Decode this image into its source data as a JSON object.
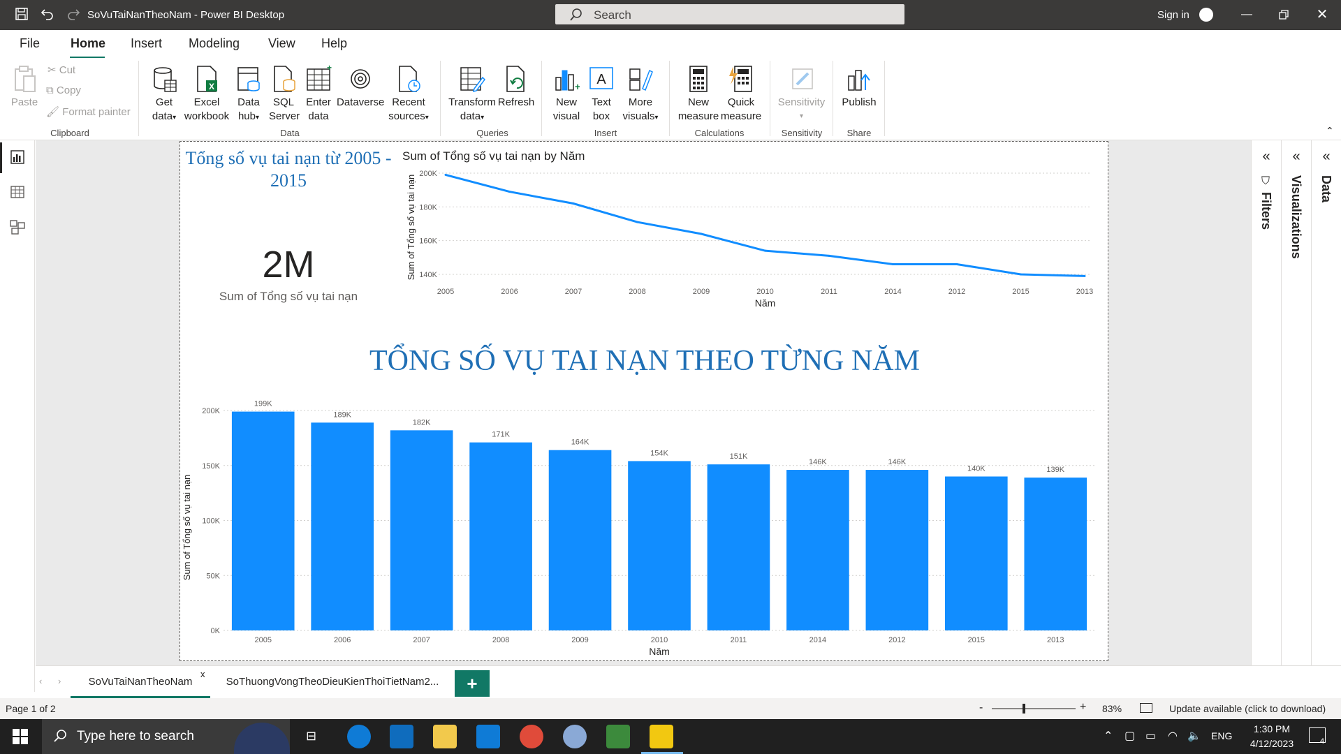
{
  "window": {
    "title": "SoVuTaiNanTheoNam - Power BI Desktop",
    "search_placeholder": "Search",
    "signin_label": "Sign in"
  },
  "menu": {
    "items": [
      "File",
      "Home",
      "Insert",
      "Modeling",
      "View",
      "Help"
    ],
    "active": "Home"
  },
  "ribbon": {
    "clipboard": {
      "paste": "Paste",
      "cut": "Cut",
      "copy": "Copy",
      "format_painter": "Format painter",
      "group": "Clipboard"
    },
    "data": {
      "get_data": [
        "Get",
        "data"
      ],
      "excel": [
        "Excel",
        "workbook"
      ],
      "data_hub": [
        "Data",
        "hub"
      ],
      "sql": [
        "SQL",
        "Server"
      ],
      "enter": [
        "Enter",
        "data"
      ],
      "dataverse": "Dataverse",
      "recent": [
        "Recent",
        "sources"
      ],
      "group": "Data"
    },
    "queries": {
      "transform": [
        "Transform",
        "data"
      ],
      "refresh": "Refresh",
      "group": "Queries"
    },
    "insert": {
      "new_visual": [
        "New",
        "visual"
      ],
      "text_box": [
        "Text",
        "box"
      ],
      "more_visuals": [
        "More",
        "visuals"
      ],
      "group": "Insert"
    },
    "calculations": {
      "new_measure": [
        "New",
        "measure"
      ],
      "quick_measure": [
        "Quick",
        "measure"
      ],
      "group": "Calculations"
    },
    "sensitivity": {
      "label": "Sensitivity",
      "group": "Sensitivity"
    },
    "share": {
      "publish": "Publish",
      "group": "Share"
    }
  },
  "panes": {
    "filters": "Filters",
    "visualizations": "Visualizations",
    "data": "Data"
  },
  "report": {
    "card_title": "Tổng số vụ tai nạn từ 2005 - 2015",
    "card_value": "2M",
    "card_label": "Sum of Tổng số vụ tai nạn",
    "big_title": "TỔNG SỐ VỤ TAI NẠN THEO TỪNG NĂM"
  },
  "chart_data": [
    {
      "type": "line",
      "title": "Sum of Tổng số vụ tai nạn by Năm",
      "xlabel": "Năm",
      "ylabel": "Sum of Tổng số vụ tai nạn",
      "categories": [
        "2005",
        "2006",
        "2007",
        "2008",
        "2009",
        "2010",
        "2011",
        "2014",
        "2012",
        "2015",
        "2013"
      ],
      "values": [
        199000,
        189000,
        182000,
        171000,
        164000,
        154000,
        151000,
        146000,
        146000,
        140000,
        139000
      ],
      "y_ticks": [
        "140K",
        "160K",
        "180K",
        "200K"
      ],
      "ylim": [
        140000,
        200000
      ],
      "color": "#118dff",
      "grid": true
    },
    {
      "type": "bar",
      "xlabel": "Năm",
      "ylabel": "Sum of Tổng số vụ tai nạn",
      "categories": [
        "2005",
        "2006",
        "2007",
        "2008",
        "2009",
        "2010",
        "2011",
        "2014",
        "2012",
        "2015",
        "2013"
      ],
      "values": [
        199000,
        189000,
        182000,
        171000,
        164000,
        154000,
        151000,
        146000,
        146000,
        140000,
        139000
      ],
      "data_labels": [
        "199K",
        "189K",
        "182K",
        "171K",
        "164K",
        "154K",
        "151K",
        "146K",
        "146K",
        "140K",
        "139K"
      ],
      "y_ticks": [
        "0K",
        "50K",
        "100K",
        "150K",
        "200K"
      ],
      "ylim": [
        0,
        200000
      ],
      "color": "#118dff",
      "grid": true
    }
  ],
  "tabs": {
    "pages": [
      "SoVuTaiNanTheoNam",
      "SoThuongVongTheoDieuKienThoiTietNam2..."
    ],
    "active_close": "x",
    "add": "+"
  },
  "status": {
    "page": "Page 1 of 2",
    "zoom_minus": "-",
    "zoom_plus": "+",
    "zoom": "83%",
    "update": "Update available (click to download)"
  },
  "taskbar": {
    "search": "Type here to search",
    "lang": "ENG",
    "time": "1:30 PM",
    "date": "4/12/2023",
    "notifications": "4"
  },
  "colors": {
    "accent": "#117865",
    "series": "#118dff",
    "titlebar": "#3b3a39"
  }
}
